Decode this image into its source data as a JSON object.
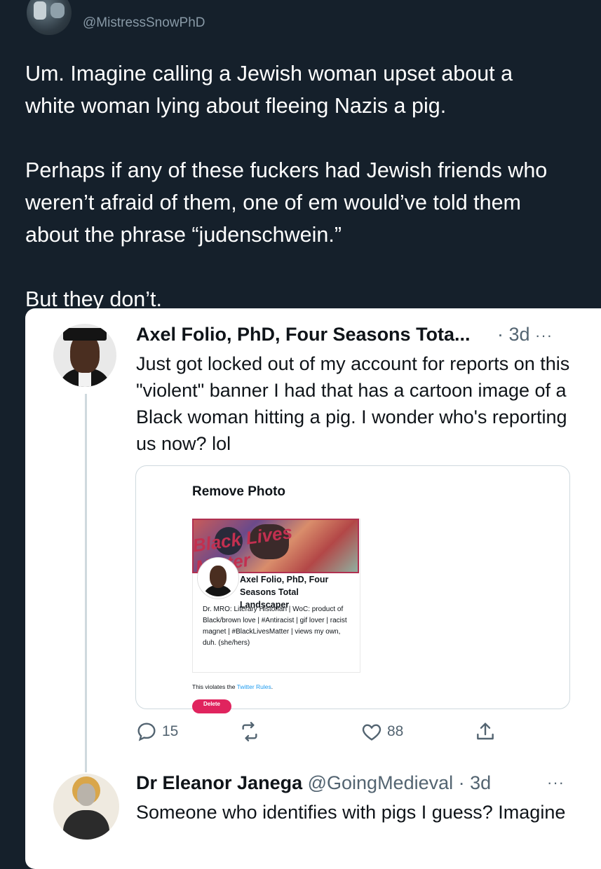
{
  "main_tweet": {
    "handle": "@MistressSnowPhD",
    "paragraphs": [
      "Um. Imagine calling a Jewish woman upset about a\nwhite woman lying about fleeing Nazis a pig.",
      "Perhaps if any of these fuckers had Jewish friends who\nweren’t afraid of them, one of em would’ve told them\nabout the phrase “judenschwein.”",
      "But they don’t."
    ]
  },
  "quoted_tweet": {
    "author": "Axel Folio, PhD, Four Seasons Tota...",
    "time": "· 3d",
    "more": "···",
    "text": "Just got locked out of my account for reports on this \"violent\" banner I had that has a cartoon image of a Black woman hitting a pig. I wonder who's reporting us now? lol",
    "embedded_screenshot": {
      "title": "Remove Photo",
      "banner_text": "Black Lives Matter",
      "profile_name": "Axel Folio, PhD, Four Seasons Total Landscaper",
      "bio": "Dr. MRO: Literary Historian | WoC: product of Black/brown love | #Antiracist | gif lover | racist magnet | #BlackLivesMatter | views my own, duh. (she/hers)",
      "violates_prefix": "This violates the ",
      "violates_link": "Twitter Rules",
      "violates_suffix": ".",
      "delete_label": "Delete"
    },
    "actions": {
      "reply_count": "15",
      "retweet_count": "",
      "like_count": "88"
    }
  },
  "reply_tweet": {
    "author": "Dr Eleanor Janega",
    "handle_time": "@GoingMedieval · 3d",
    "more": "···",
    "text": "Someone who identifies with pigs I guess? Imagine"
  },
  "colors": {
    "background": "#15202b",
    "card": "#ffffff",
    "muted": "#536471",
    "link": "#1d9bf0",
    "delete": "#e0245e"
  }
}
